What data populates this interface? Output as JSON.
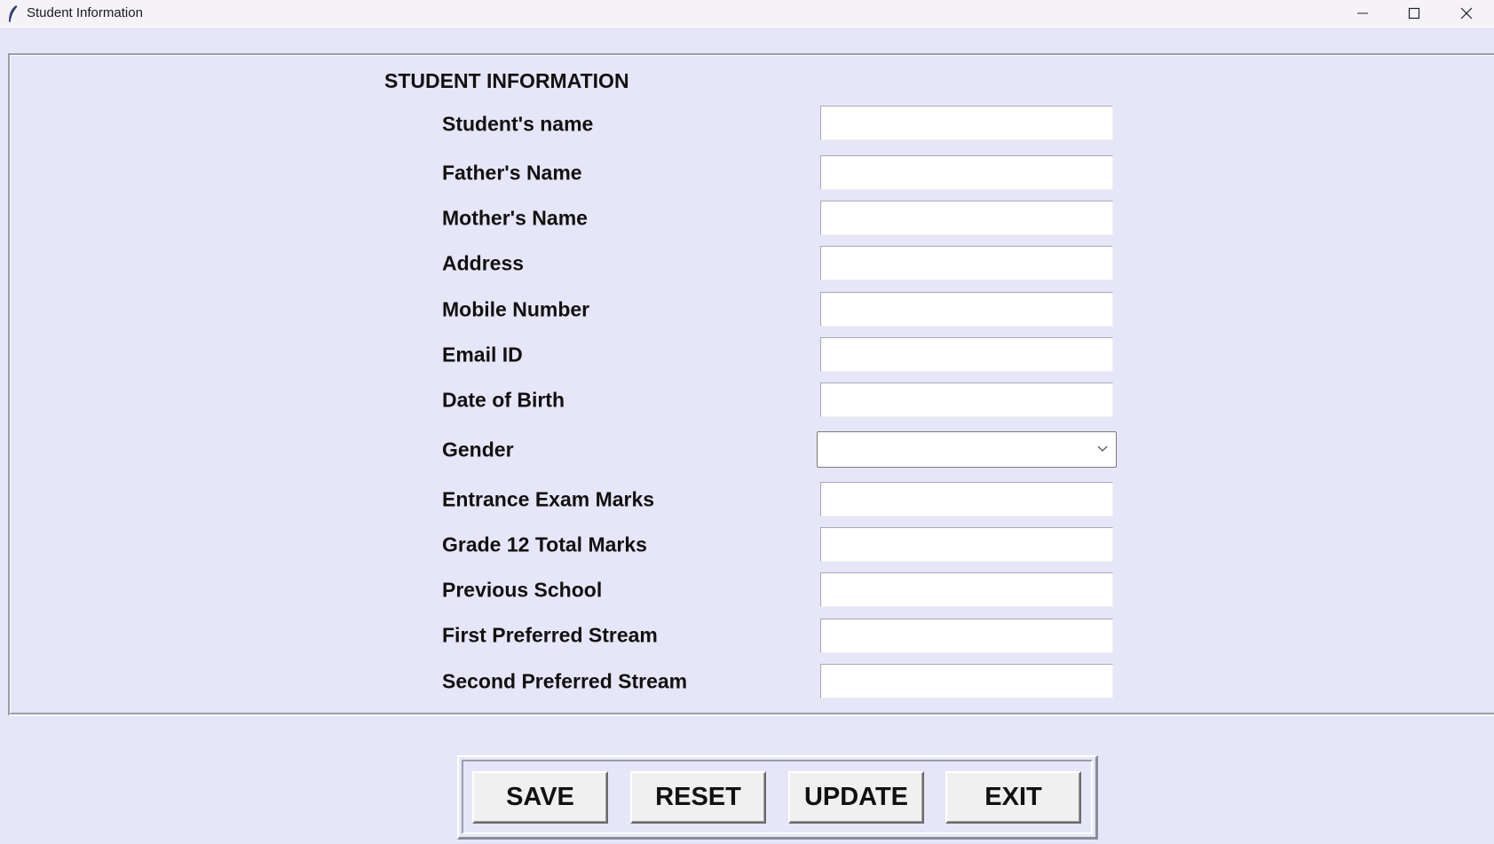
{
  "window": {
    "title": "Student Information",
    "icons": {
      "app": "feather-icon",
      "minimize": "minimize-icon",
      "maximize": "maximize-icon",
      "close": "close-icon"
    }
  },
  "form": {
    "heading": "STUDENT INFORMATION",
    "fields": [
      {
        "label": "Student's name",
        "value": ""
      },
      {
        "label": "Father's Name",
        "value": ""
      },
      {
        "label": "Mother's Name",
        "value": ""
      },
      {
        "label": "Address",
        "value": ""
      },
      {
        "label": "Mobile Number",
        "value": ""
      },
      {
        "label": "Email ID",
        "value": ""
      },
      {
        "label": "Date of Birth",
        "value": ""
      },
      {
        "label": "Gender",
        "value": "",
        "type": "combobox"
      },
      {
        "label": "Entrance Exam Marks",
        "value": ""
      },
      {
        "label": "Grade 12 Total Marks",
        "value": ""
      },
      {
        "label": "Previous School",
        "value": ""
      },
      {
        "label": "First Preferred Stream",
        "value": ""
      },
      {
        "label": "Second Preferred Stream",
        "value": ""
      }
    ]
  },
  "buttons": {
    "save": "SAVE",
    "reset": "RESET",
    "update": "UPDATE",
    "exit": "EXIT"
  }
}
